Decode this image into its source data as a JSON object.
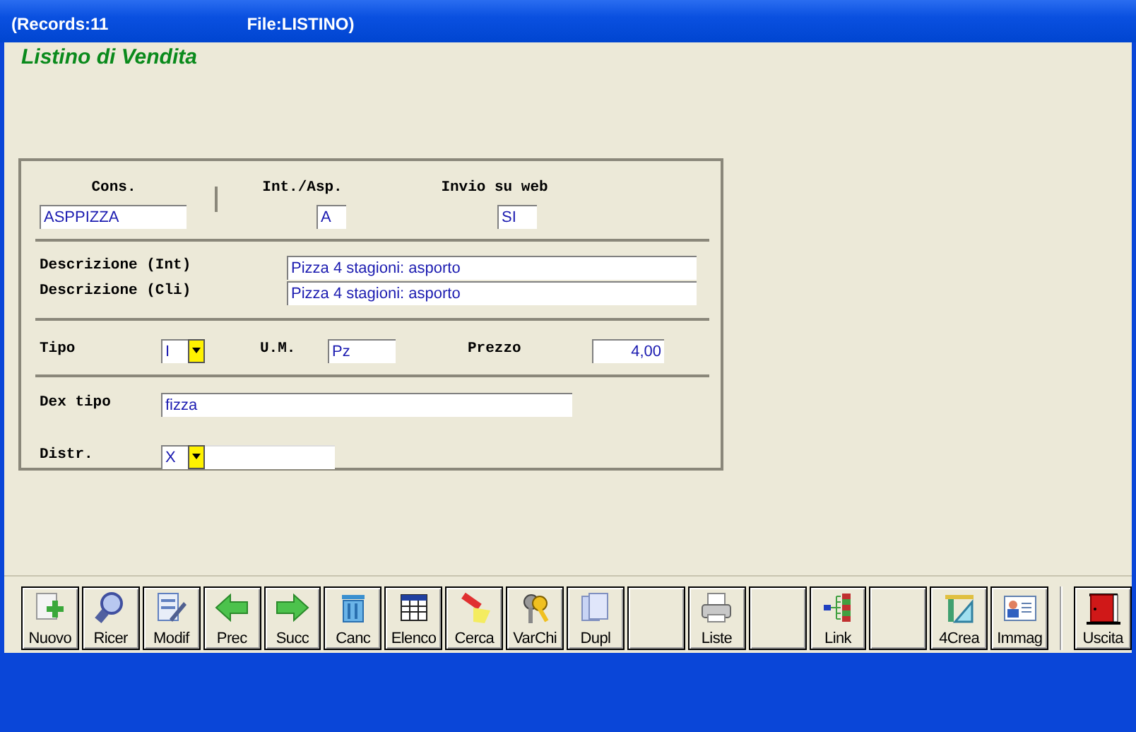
{
  "window": {
    "records": "(Records:11",
    "file": "File:LISTINO)"
  },
  "heading": "Listino di Vendita",
  "form": {
    "cons": {
      "label": "Cons.",
      "value": "ASPPIZZA"
    },
    "int_asp": {
      "label": "Int./Asp.",
      "value": "A"
    },
    "invio_web": {
      "label": "Invio su web",
      "value": "SI"
    },
    "desc_int": {
      "label": "Descrizione (Int)",
      "value": "Pizza 4 stagioni: asporto"
    },
    "desc_cli": {
      "label": "Descrizione (Cli)",
      "value": "Pizza 4 stagioni: asporto"
    },
    "tipo": {
      "label": "Tipo",
      "value": "I"
    },
    "um": {
      "label": "U.M.",
      "value": "Pz"
    },
    "prezzo": {
      "label": "Prezzo",
      "value": "4,00"
    },
    "dex_tipo": {
      "label": "Dex tipo",
      "value": "fizza"
    },
    "distr": {
      "label": "Distr.",
      "value": "X"
    }
  },
  "toolbar": [
    {
      "kind": "new",
      "label": "Nuovo"
    },
    {
      "kind": "search",
      "label": "Ricer"
    },
    {
      "kind": "edit",
      "label": "Modif"
    },
    {
      "kind": "prev",
      "label": "Prec"
    },
    {
      "kind": "next",
      "label": "Succ"
    },
    {
      "kind": "delete",
      "label": "Canc"
    },
    {
      "kind": "list",
      "label": "Elenco"
    },
    {
      "kind": "find",
      "label": "Cerca"
    },
    {
      "kind": "keys",
      "label": "VarChi"
    },
    {
      "kind": "copy",
      "label": "Dupl"
    },
    {
      "kind": "blank"
    },
    {
      "kind": "print",
      "label": "Liste"
    },
    {
      "kind": "blank"
    },
    {
      "kind": "link",
      "label": "Link"
    },
    {
      "kind": "blank"
    },
    {
      "kind": "create",
      "label": "4Crea"
    },
    {
      "kind": "image",
      "label": "Immag"
    },
    {
      "kind": "exit",
      "label": "Uscita"
    }
  ]
}
